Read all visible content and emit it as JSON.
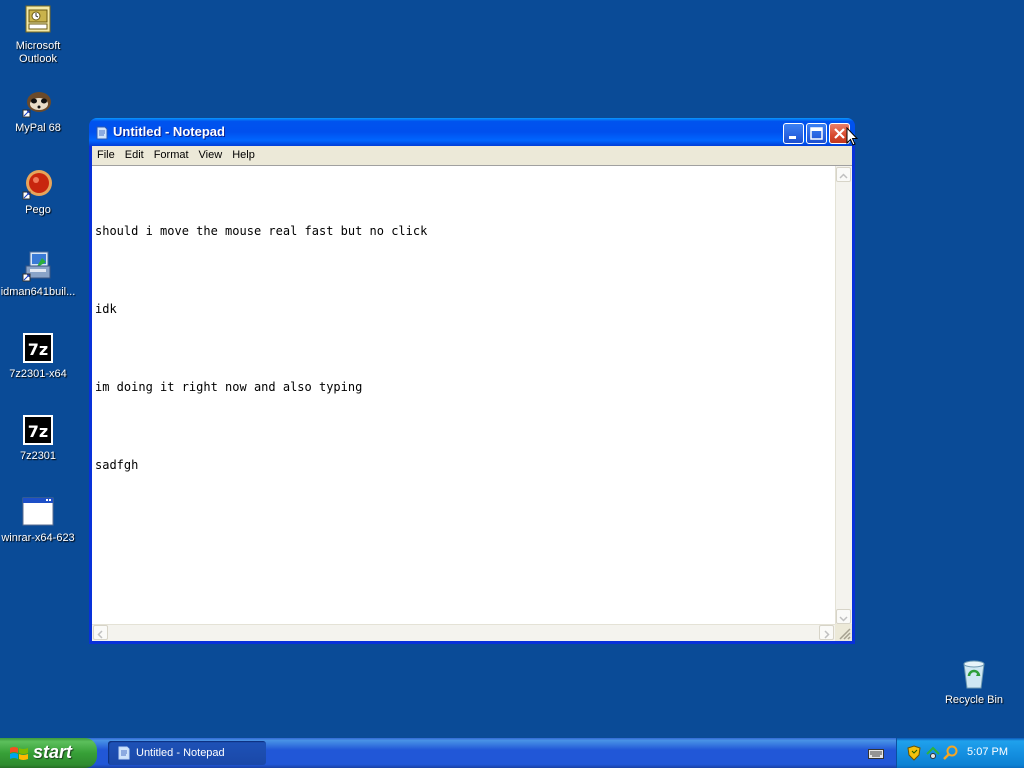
{
  "desktop": {
    "icons": [
      {
        "label": "Microsoft Outlook",
        "line1": "Microsoft",
        "line2": "Outlook",
        "icon": "outlook-icon"
      },
      {
        "label": "MyPal 68",
        "icon": "mypal-icon"
      },
      {
        "label": "Pego",
        "icon": "pego-icon"
      },
      {
        "label": "idman641buil...",
        "icon": "installer-icon"
      },
      {
        "label": "7z2301-x64",
        "icon": "7zip-icon"
      },
      {
        "label": "7z2301",
        "icon": "7zip-icon"
      },
      {
        "label": "winrar-x64-623",
        "icon": "window-app-icon"
      },
      {
        "label": "Recycle Bin",
        "icon": "recycle-bin-icon"
      }
    ],
    "background_color": "#0a4b97"
  },
  "notepad": {
    "title": "Untitled - Notepad",
    "menu": [
      "File",
      "Edit",
      "Format",
      "View",
      "Help"
    ],
    "lines": [
      "should i move the mouse real fast but no click",
      "idk",
      "im doing it right now and also typing",
      "sadfgh"
    ]
  },
  "taskbar": {
    "start_label": "start",
    "task_items": [
      "Untitled - Notepad"
    ],
    "clock": "5:07 PM",
    "accent": "#2157d7",
    "start_color": "#37a037"
  }
}
